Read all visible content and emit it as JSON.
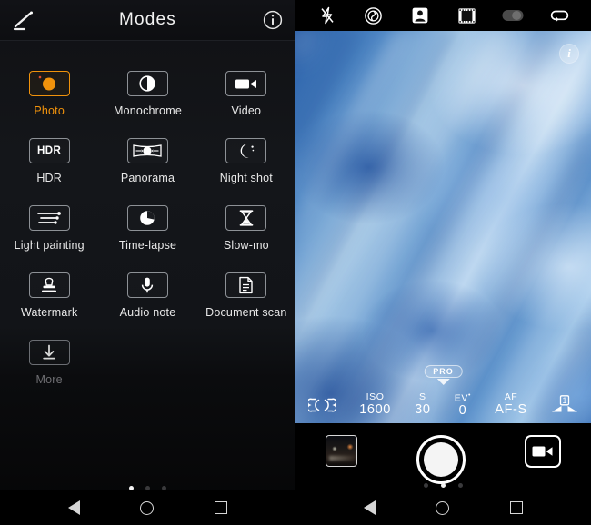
{
  "left": {
    "header": {
      "title": "Modes",
      "edit_icon": "magic-wand-icon",
      "info_icon": "info-icon"
    },
    "modes": [
      {
        "label": "Photo",
        "icon": "camera-icon",
        "selected": true,
        "dim": false
      },
      {
        "label": "Monochrome",
        "icon": "contrast-icon",
        "selected": false,
        "dim": false
      },
      {
        "label": "Video",
        "icon": "video-camera-icon",
        "selected": false,
        "dim": false
      },
      {
        "label": "HDR",
        "icon": "hdr-text-icon",
        "selected": false,
        "dim": false
      },
      {
        "label": "Panorama",
        "icon": "panorama-icon",
        "selected": false,
        "dim": false
      },
      {
        "label": "Night shot",
        "icon": "moon-stars-icon",
        "selected": false,
        "dim": false
      },
      {
        "label": "Light painting",
        "icon": "light-trails-icon",
        "selected": false,
        "dim": false
      },
      {
        "label": "Time-lapse",
        "icon": "pie-clock-icon",
        "selected": false,
        "dim": false
      },
      {
        "label": "Slow-mo",
        "icon": "hourglass-icon",
        "selected": false,
        "dim": false
      },
      {
        "label": "Watermark",
        "icon": "stamp-icon",
        "selected": false,
        "dim": false
      },
      {
        "label": "Audio note",
        "icon": "microphone-icon",
        "selected": false,
        "dim": false
      },
      {
        "label": "Document scan",
        "icon": "document-icon",
        "selected": false,
        "dim": false
      },
      {
        "label": "More",
        "icon": "download-arrow-icon",
        "selected": false,
        "dim": true
      }
    ],
    "hdr_icon_text": "HDR",
    "page_dots": {
      "count": 3,
      "active_index": 0
    },
    "accent_color": "#f0920c",
    "navbar": {
      "back": "back-triangle-icon",
      "home": "home-circle-icon",
      "recents": "recents-square-icon"
    }
  },
  "right": {
    "toolbar": [
      {
        "name": "flash-off-icon",
        "label": "Flash off"
      },
      {
        "name": "aperture-icon",
        "label": "Aperture"
      },
      {
        "name": "portrait-icon",
        "label": "Portrait"
      },
      {
        "name": "filmstrip-icon",
        "label": "Filters"
      },
      {
        "name": "toggle-switch-icon",
        "label": "Toggle"
      },
      {
        "name": "loop-rotate-icon",
        "label": "Switch camera"
      }
    ],
    "viewfinder": {
      "info_badge": "i",
      "pro_badge": "PRO"
    },
    "pro_bar": {
      "metering_icon": "metering-bracket-icon",
      "settings": [
        {
          "key": "ISO",
          "value": "1600"
        },
        {
          "key": "S",
          "value": "30"
        },
        {
          "key": "EV",
          "value": "0"
        },
        {
          "key": "AF",
          "value": "AF-S"
        }
      ],
      "flash_compensation": "1"
    },
    "controls": {
      "gallery_thumb": "gallery-thumbnail",
      "shutter": "shutter-button",
      "video": "video-record-button"
    },
    "page_dots": {
      "count": 3,
      "active_index": 1
    },
    "navbar": {
      "back": "back-triangle-icon",
      "home": "home-circle-icon",
      "recents": "recents-square-icon"
    }
  }
}
